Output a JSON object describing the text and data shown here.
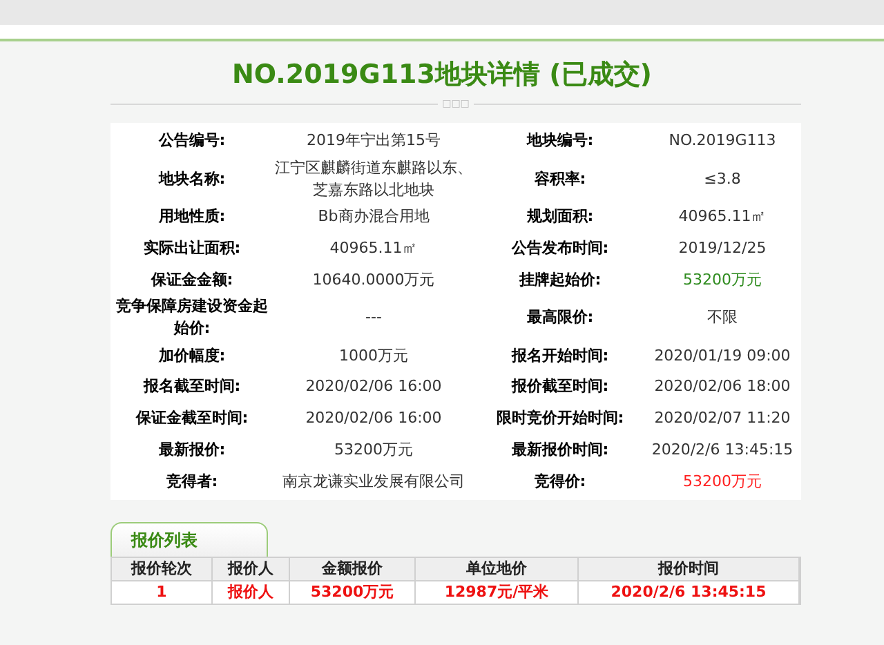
{
  "title": "NO.2019G113地块详情 (已成交)",
  "divider_mark": "□□□",
  "details": [
    {
      "pairs": [
        {
          "label": "公告编号:",
          "value": "2019年宁出第15号"
        },
        {
          "label": "地块编号:",
          "value": "NO.2019G113"
        }
      ]
    },
    {
      "pairs": [
        {
          "label": "地块名称:",
          "value": "江宁区麒麟街道东麒路以东、芝嘉东路以北地块"
        },
        {
          "label": "容积率:",
          "value": "≤3.8"
        }
      ]
    },
    {
      "pairs": [
        {
          "label": "用地性质:",
          "value": "Bb商办混合用地"
        },
        {
          "label": "规划面积:",
          "value": "40965.11㎡"
        }
      ]
    },
    {
      "pairs": [
        {
          "label": "实际出让面积:",
          "value": "40965.11㎡"
        },
        {
          "label": "公告发布时间:",
          "value": "2019/12/25"
        }
      ]
    },
    {
      "pairs": [
        {
          "label": "保证金金额:",
          "value": "10640.0000万元"
        },
        {
          "label": "挂牌起始价:",
          "value": "53200万元",
          "color": "#2e8b1e"
        }
      ]
    },
    {
      "pairs": [
        {
          "label": "竞争保障房建设资金起始价:",
          "value": "---"
        },
        {
          "label": "最高限价:",
          "value": "不限"
        }
      ]
    },
    {
      "pairs": [
        {
          "label": "加价幅度:",
          "value": "1000万元"
        },
        {
          "label": "报名开始时间:",
          "value": "2020/01/19 09:00"
        }
      ]
    },
    {
      "pairs": [
        {
          "label": "报名截至时间:",
          "value": "2020/02/06 16:00"
        },
        {
          "label": "报价截至时间:",
          "value": "2020/02/06 18:00"
        }
      ]
    },
    {
      "pairs": [
        {
          "label": "保证金截至时间:",
          "value": "2020/02/06 16:00"
        },
        {
          "label": "限时竞价开始时间:",
          "value": "2020/02/07 11:20"
        }
      ]
    },
    {
      "pairs": [
        {
          "label": "最新报价:",
          "value": "53200万元"
        },
        {
          "label": "最新报价时间:",
          "value": "2020/2/6 13:45:15"
        }
      ]
    },
    {
      "pairs": [
        {
          "label": "竞得者:",
          "value": "南京龙谦实业发展有限公司"
        },
        {
          "label": "竞得价:",
          "value": "53200万元",
          "color": "#ff2020"
        }
      ]
    }
  ],
  "bids": {
    "tab": "报价列表",
    "columns": [
      "报价轮次",
      "报价人",
      "金额报价",
      "单位地价",
      "报价时间"
    ],
    "rows": [
      [
        "1",
        "报价人",
        "53200万元",
        "12987元/平米",
        "2020/2/6 13:45:15"
      ]
    ]
  }
}
